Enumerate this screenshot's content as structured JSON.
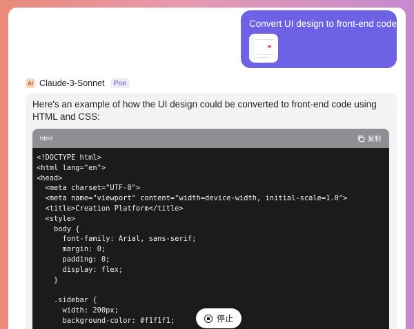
{
  "user_message": {
    "text": "Convert UI design to front-end code",
    "attachment_icon": "image-thumbnail-icon"
  },
  "bot": {
    "name": "Claude-3-Sonnet",
    "badge": "Poe",
    "avatar_icon": "anthropic-logo-icon",
    "avatar_glyph": "AI",
    "intro": "Here's an example of how the UI design could be converted to front-end code using HTML and CSS:"
  },
  "code_block": {
    "language": "html",
    "copy_label": "复制",
    "copy_icon": "copy-icon",
    "code": "<!DOCTYPE html>\n<html lang=\"en\">\n<head>\n  <meta charset=\"UTF-8\">\n  <meta name=\"viewport\" content=\"width=device-width, initial-scale=1.0\">\n  <title>Creation Platform</title>\n  <style>\n    body {\n      font-family: Arial, sans-serif;\n      margin: 0;\n      padding: 0;\n      display: flex;\n    }\n\n    .sidebar {\n      width: 200px;\n      background-color: #f1f1f1;"
  },
  "stop_button": {
    "label": "停止",
    "icon": "stop-circle-icon"
  },
  "colors": {
    "user_bubble": "#6d62e6",
    "code_header": "#8e8f93",
    "code_background": "#1b1b1c",
    "bot_bubble": "#f3f3f5"
  }
}
